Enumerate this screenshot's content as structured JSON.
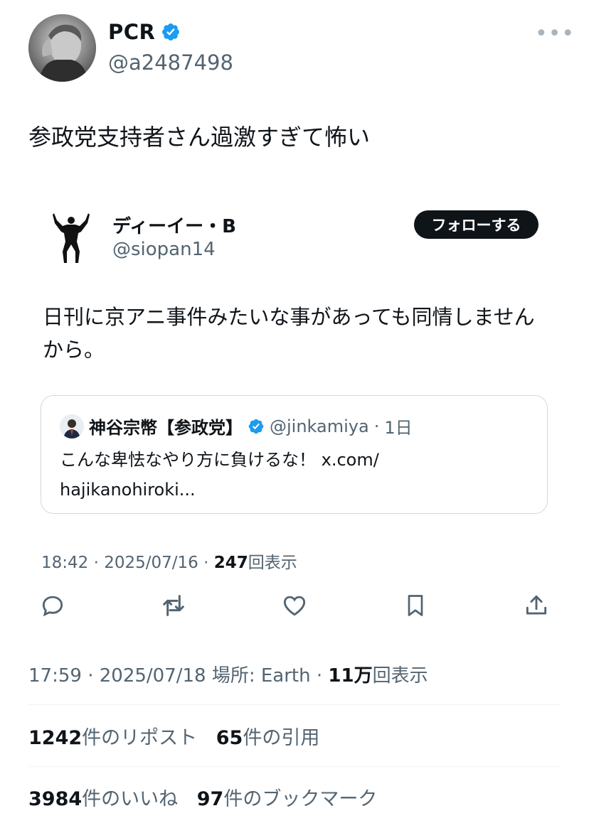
{
  "author": {
    "name": "PCR",
    "handle": "@a2487498"
  },
  "tweet": {
    "text": "参政党支持者さん過激すぎて怖い"
  },
  "quoted": {
    "name": "ディーイー・B",
    "handle": "@siopan14",
    "follow_label": "フォローする",
    "text": "日刊に京アニ事件みたいな事があっても同情しませんから。",
    "inner": {
      "name": "神谷宗幣【参政党】",
      "handle": "@jinkamiya",
      "sep": "·",
      "age": "1日",
      "text_line1": "こんな卑怯なやり方に負けるな！ x.com/",
      "text_line2": "hajikanohiroki..."
    },
    "meta": {
      "time": "18:42",
      "sep1": "·",
      "date": "2025/07/16",
      "sep2": "·",
      "views": "247",
      "views_label": "回表示"
    }
  },
  "meta": {
    "time": "17:59",
    "sep1": "·",
    "date": "2025/07/18",
    "location": "場所: Earth",
    "sep2": "·",
    "views": "11万",
    "views_label": "回表示"
  },
  "stats": {
    "reposts": "1242",
    "reposts_label": "件のリポスト",
    "quotes": "65",
    "quotes_label": "件の引用",
    "likes": "3984",
    "likes_label": "件のいいね",
    "bookmarks": "97",
    "bookmarks_label": "件のブックマーク"
  },
  "colors": {
    "verified": "#1d9bf0",
    "text": "#0f1419",
    "secondary": "#536471"
  }
}
